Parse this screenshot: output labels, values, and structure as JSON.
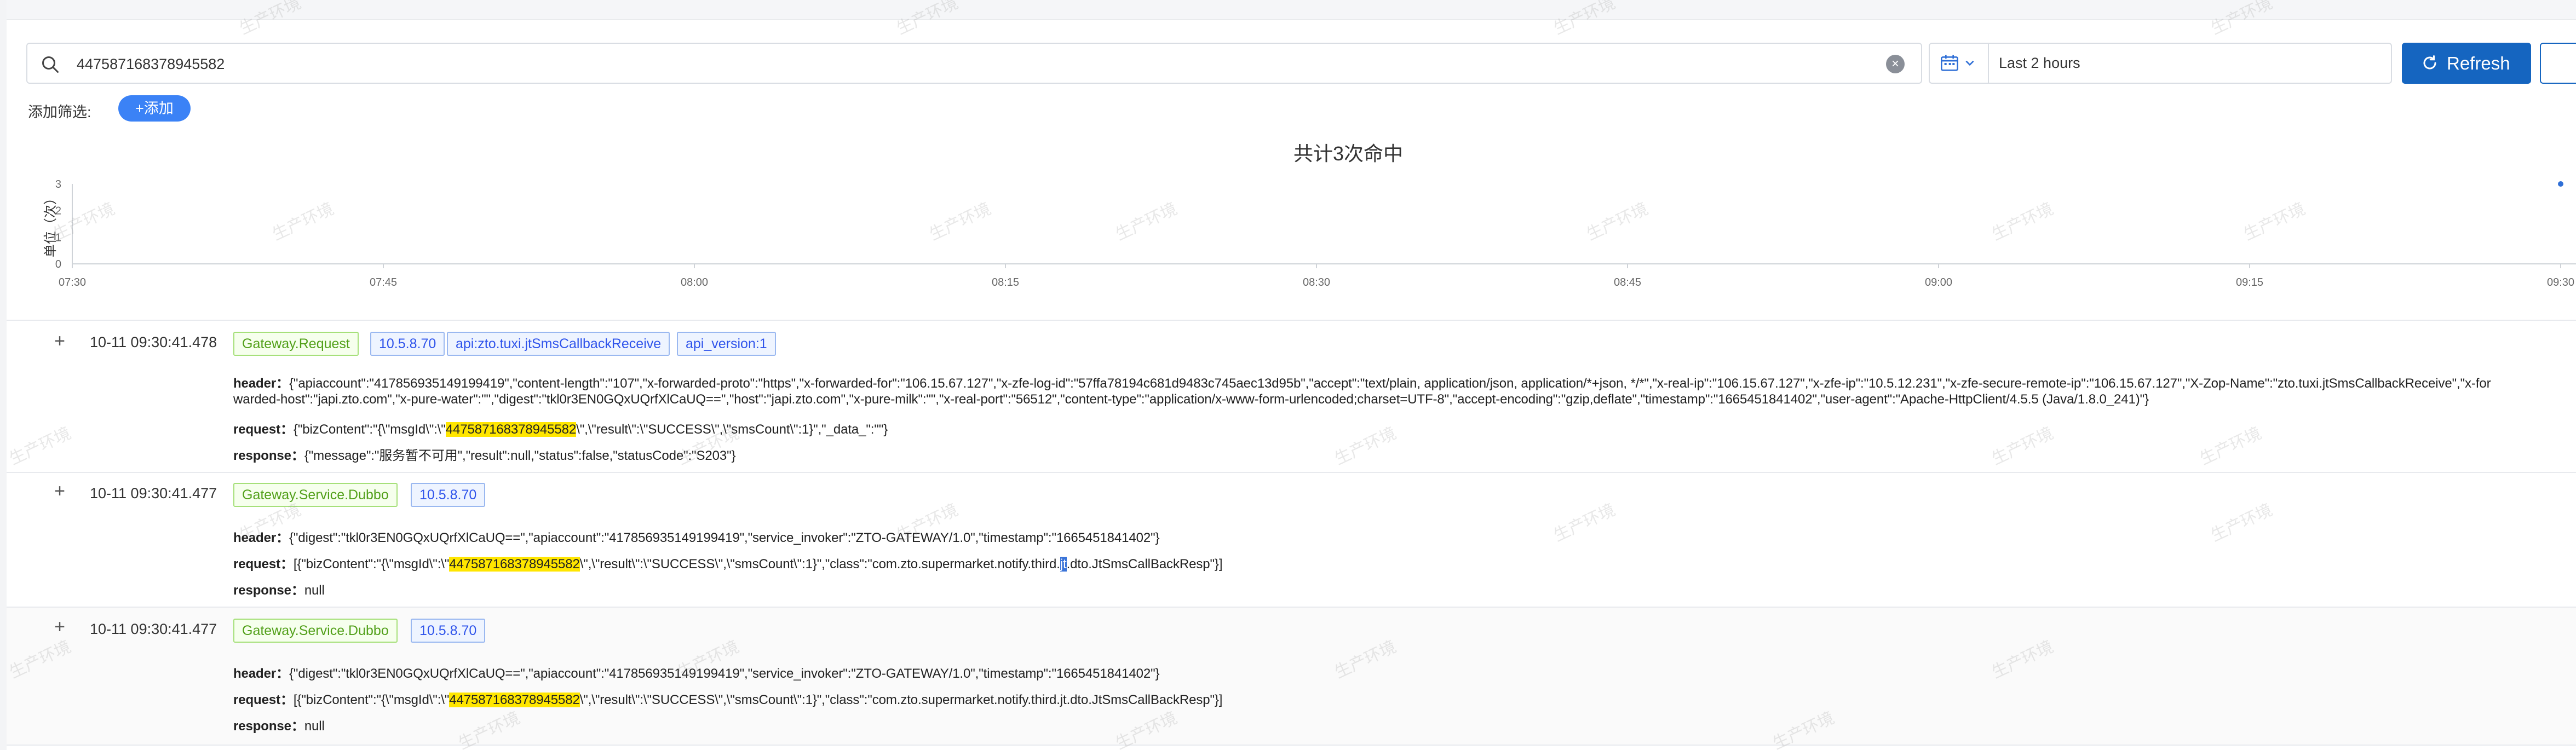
{
  "search": {
    "value": "447587168378945582"
  },
  "time_range": {
    "label": "Last 2 hours"
  },
  "refresh_label": "Refresh",
  "filter": {
    "label": "添加筛选:",
    "add_label": "+添加"
  },
  "watermark": "生产环境",
  "chart_data": {
    "type": "line",
    "title": "共计3次命中",
    "ylabel": "单位（次）",
    "ylim": [
      0,
      3
    ],
    "yticks": [
      "0",
      "1",
      "2",
      "3"
    ],
    "x_ticks": [
      "07:30",
      "07:45",
      "08:00",
      "08:15",
      "08:30",
      "08:45",
      "09:00",
      "09:15",
      "09:30"
    ],
    "series": [
      {
        "x": [
          "09:30"
        ],
        "values": [
          3
        ]
      }
    ]
  },
  "records": [
    {
      "time": "10-11 09:30:41.478",
      "tags": [
        "Gateway.Request",
        "10.5.8.70",
        "api:zto.tuxi.jtSmsCallbackReceive",
        "api_version:1"
      ],
      "header_label": "header：",
      "header_1": "{\"apiaccount\":\"417856935149199419\",\"content-length\":\"107\",\"x-forwarded-proto\":\"https\",\"x-forwarded-for\":\"106.15.67.127\",\"x-zfe-log-id\":\"57ffa78194c681d9483c745aec13d95b\",\"accept\":\"text/plain, application/json, application/*+json, */*\",\"x-real-ip\":\"106.15.67.127\",\"x-zfe-ip\":\"10.5.12.231\",\"x-zfe-secure-remote-ip\":\"106.15.67.127\",\"X-Zop-Name\":\"zto.tuxi.jtSmsCallbackReceive\",\"x-for",
      "header_2": "warded-host\":\"japi.zto.com\",\"x-pure-water\":\"\",\"digest\":\"tkl0r3EN0GQxUQrfXlCaUQ==\",\"host\":\"japi.zto.com\",\"x-pure-milk\":\"\",\"x-real-port\":\"56512\",\"content-type\":\"application/x-www-form-urlencoded;charset=UTF-8\",\"accept-encoding\":\"gzip,deflate\",\"timestamp\":\"1665451841402\",\"user-agent\":\"Apache-HttpClient/4.5.5 (Java/1.8.0_241)\"}",
      "request_label": "request：",
      "request_pre": "{\"bizContent\":\"{\\\"msgId\\\":\\\"",
      "request_hl": "447587168378945582",
      "request_post": "\\\",\\\"result\\\":\\\"SUCCESS\\\",\\\"smsCount\\\":1}\",\"_data_\":\"\"}",
      "response_label": "response：",
      "response": "{\"message\":\"服务暂不可用\",\"result\":null,\"status\":false,\"statusCode\":\"S203\"}"
    },
    {
      "time": "10-11 09:30:41.477",
      "tags": [
        "Gateway.Service.Dubbo",
        "10.5.8.70"
      ],
      "header_label": "header：",
      "header_1": "{\"digest\":\"tkl0r3EN0GQxUQrfXlCaUQ==\",\"apiaccount\":\"417856935149199419\",\"service_invoker\":\"ZTO-GATEWAY/1.0\",\"timestamp\":\"1665451841402\"}",
      "request_label": "request：",
      "request_pre": "[{\"bizContent\":\"{\\\"msgId\\\":\\\"",
      "request_hl": "447587168378945582",
      "request_mid": "\\\",\\\"result\\\":\\\"SUCCESS\\\",\\\"smsCount\\\":1}\",\"class\":\"com.zto.supermarket.notify.third.",
      "request_cur": "jt",
      "request_post": ".dto.JtSmsCallBackResp\"}]",
      "response_label": "response：",
      "response": "null"
    },
    {
      "time": "10-11 09:30:41.477",
      "tags": [
        "Gateway.Service.Dubbo",
        "10.5.8.70"
      ],
      "header_label": "header：",
      "header_1": "{\"digest\":\"tkl0r3EN0GQxUQrfXlCaUQ==\",\"apiaccount\":\"417856935149199419\",\"service_invoker\":\"ZTO-GATEWAY/1.0\",\"timestamp\":\"1665451841402\"}",
      "request_label": "request：",
      "request_pre": "[{\"bizContent\":\"{\\\"msgId\\\":\\\"",
      "request_hl": "447587168378945582",
      "request_post": "\\\",\\\"result\\\":\\\"SUCCESS\\\",\\\"smsCount\\\":1}\",\"class\":\"com.zto.supermarket.notify.third.jt.dto.JtSmsCallBackResp\"}]",
      "response_label": "response：",
      "response": "null"
    }
  ]
}
